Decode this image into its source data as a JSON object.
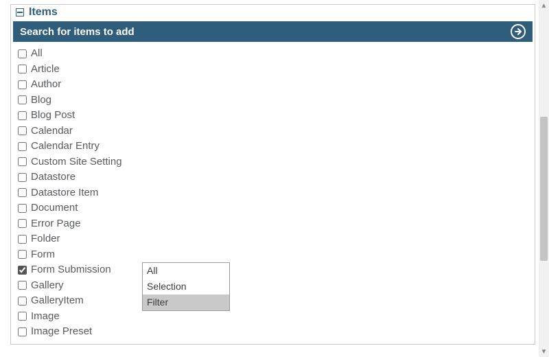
{
  "panel": {
    "title": "Items",
    "collapse_icon": "minus-icon"
  },
  "search": {
    "placeholder": "Search for items to add",
    "go_icon": "arrow-right-circle-icon"
  },
  "items": [
    {
      "label": "All",
      "checked": false
    },
    {
      "label": "Article",
      "checked": false
    },
    {
      "label": "Author",
      "checked": false
    },
    {
      "label": "Blog",
      "checked": false
    },
    {
      "label": "Blog Post",
      "checked": false
    },
    {
      "label": "Calendar",
      "checked": false
    },
    {
      "label": "Calendar Entry",
      "checked": false
    },
    {
      "label": "Custom Site Setting",
      "checked": false
    },
    {
      "label": "Datastore",
      "checked": false
    },
    {
      "label": "Datastore Item",
      "checked": false
    },
    {
      "label": "Document",
      "checked": false
    },
    {
      "label": "Error Page",
      "checked": false
    },
    {
      "label": "Folder",
      "checked": false
    },
    {
      "label": "Form",
      "checked": false
    },
    {
      "label": "Form Submission",
      "checked": true
    },
    {
      "label": "Gallery",
      "checked": false
    },
    {
      "label": "GalleryItem",
      "checked": false
    },
    {
      "label": "Image",
      "checked": false
    },
    {
      "label": "Image Preset",
      "checked": false
    }
  ],
  "context_menu": {
    "attached_to_index": 14,
    "options": [
      {
        "label": "All",
        "hover": false
      },
      {
        "label": "Selection",
        "hover": false
      },
      {
        "label": "Filter",
        "hover": true
      }
    ]
  },
  "colors": {
    "accent": "#2f5d7c",
    "text": "#565a5e",
    "menu_hover": "#c9c9c9"
  }
}
